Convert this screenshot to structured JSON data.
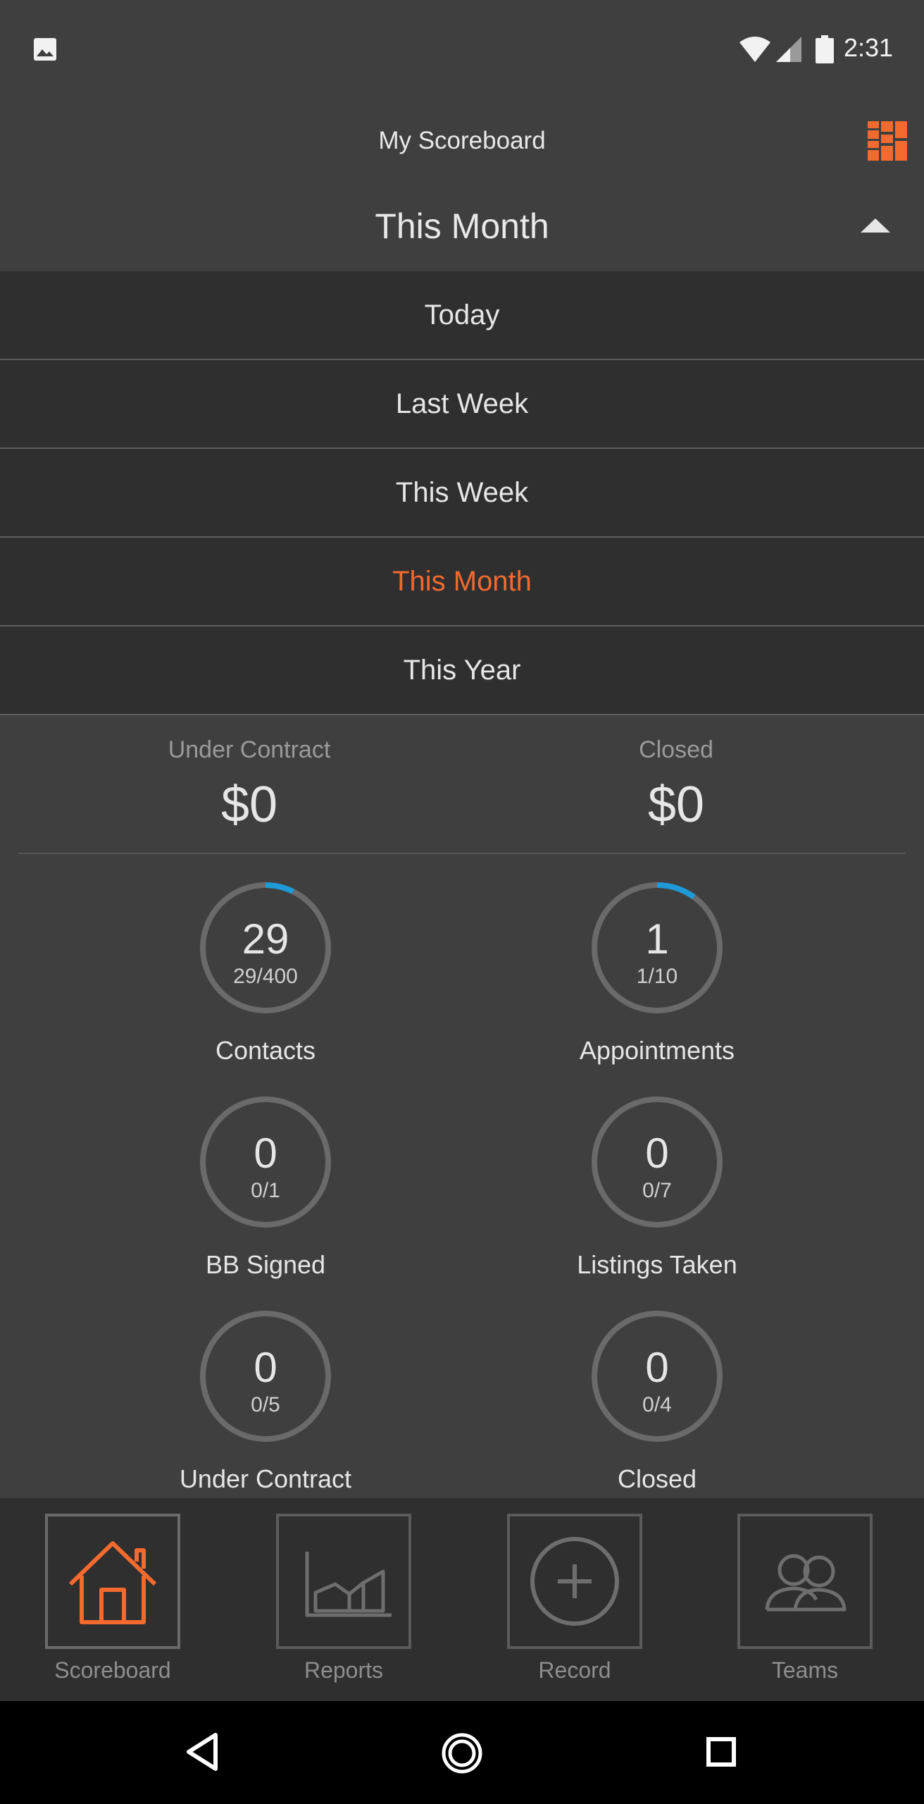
{
  "status_bar": {
    "time": "2:31"
  },
  "header": {
    "title": "My Scoreboard",
    "selected_period": "This Month"
  },
  "period_menu": {
    "items": [
      {
        "label": "Today",
        "active": false
      },
      {
        "label": "Last Week",
        "active": false
      },
      {
        "label": "This Week",
        "active": false
      },
      {
        "label": "This Month",
        "active": true
      },
      {
        "label": "This Year",
        "active": false
      }
    ]
  },
  "summary": {
    "under_contract": {
      "label": "Under Contract",
      "value": "$0"
    },
    "closed": {
      "label": "Closed",
      "value": "$0"
    }
  },
  "goals": [
    {
      "label": "Contacts",
      "value": "29",
      "fraction": "29/400",
      "progress": 0.0725
    },
    {
      "label": "Appointments",
      "value": "1",
      "fraction": "1/10",
      "progress": 0.1
    },
    {
      "label": "BB Signed",
      "value": "0",
      "fraction": "0/1",
      "progress": 0
    },
    {
      "label": "Listings Taken",
      "value": "0",
      "fraction": "0/7",
      "progress": 0
    },
    {
      "label": "Under Contract",
      "value": "0",
      "fraction": "0/5",
      "progress": 0
    },
    {
      "label": "Closed",
      "value": "0",
      "fraction": "0/4",
      "progress": 0
    }
  ],
  "bottom_nav": {
    "items": [
      {
        "label": "Scoreboard",
        "icon": "house-icon",
        "active": true
      },
      {
        "label": "Reports",
        "icon": "chart-icon",
        "active": false
      },
      {
        "label": "Record",
        "icon": "plus-circle-icon",
        "active": false
      },
      {
        "label": "Teams",
        "icon": "people-icon",
        "active": false
      }
    ]
  },
  "colors": {
    "accent": "#f26a2e",
    "progress": "#1e9ad6",
    "ring_track": "#6a6a6a",
    "background": "#3f3f40",
    "menu_background": "#2f2f30"
  }
}
